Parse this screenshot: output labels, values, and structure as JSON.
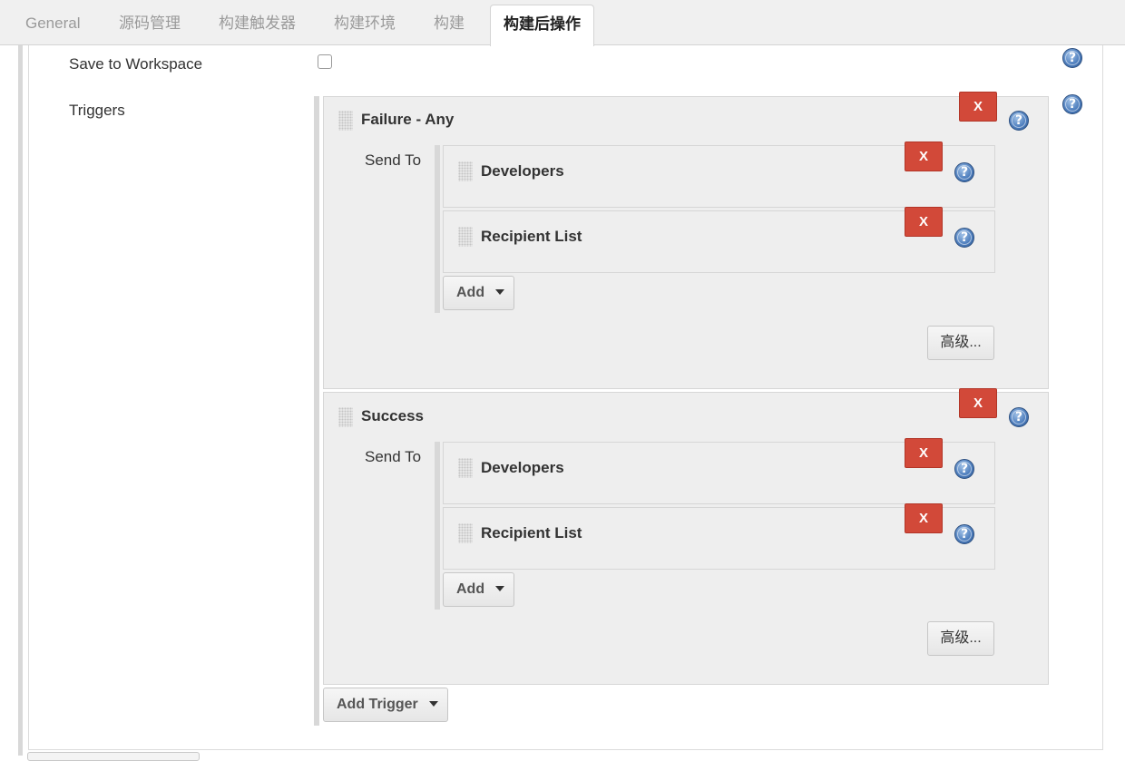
{
  "tabs": [
    {
      "label": "General",
      "active": false
    },
    {
      "label": "源码管理",
      "active": false
    },
    {
      "label": "构建触发器",
      "active": false
    },
    {
      "label": "构建环境",
      "active": false
    },
    {
      "label": "构建",
      "active": false
    },
    {
      "label": "构建后操作",
      "active": true
    }
  ],
  "form": {
    "save_to_workspace_label": "Save to Workspace",
    "save_to_workspace_checked": false,
    "triggers_label": "Triggers"
  },
  "triggers": [
    {
      "title": "Failure - Any",
      "send_to_label": "Send To",
      "recipients": [
        {
          "label": "Developers"
        },
        {
          "label": "Recipient List"
        }
      ],
      "add_label": "Add",
      "advanced_label": "高级..."
    },
    {
      "title": "Success",
      "send_to_label": "Send To",
      "recipients": [
        {
          "label": "Developers"
        },
        {
          "label": "Recipient List"
        }
      ],
      "add_label": "Add",
      "advanced_label": "高级..."
    }
  ],
  "add_trigger_label": "Add Trigger",
  "remove_label": "X",
  "help_glyph": "?",
  "icons": {
    "help": "help-icon",
    "remove": "remove-icon",
    "drag": "drag-handle-icon",
    "dropdown": "caret-down-icon"
  },
  "colors": {
    "remove_button": "#d24939",
    "help_icon": "#4f7fbe",
    "block_background": "#eeeeee",
    "tab_bar": "#f0f0f0"
  }
}
